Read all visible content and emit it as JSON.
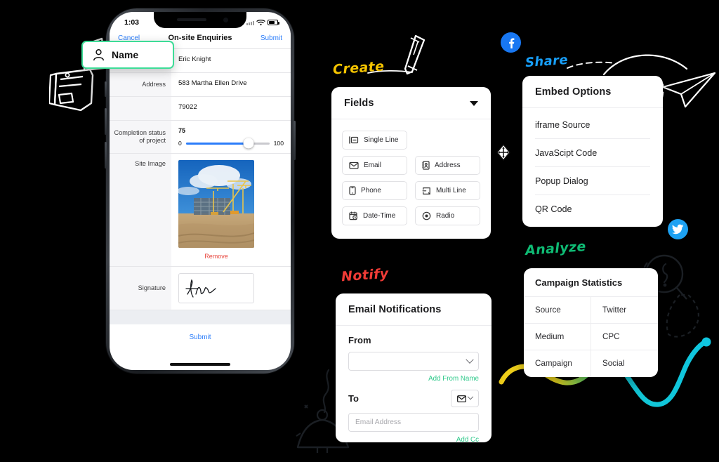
{
  "theme": {
    "background": "#000000",
    "accent_green": "#3ddc97",
    "accent_blue": "#2b7dfa",
    "link_green": "#2fc98b",
    "danger_red": "#e8453c"
  },
  "phone": {
    "status_bar": {
      "time": "1:03",
      "signal_icon": "signal-bars-icon",
      "wifi_icon": "wifi-icon",
      "battery_icon": "battery-icon"
    },
    "nav": {
      "cancel": "Cancel",
      "title": "On-site Enquiries",
      "submit": "Submit"
    },
    "form": {
      "rows": [
        {
          "label": "Name",
          "value": "Eric Knight"
        },
        {
          "label": "Address",
          "value": "583 Martha Ellen Drive"
        },
        {
          "label": "",
          "value": "79022"
        }
      ],
      "slider": {
        "label": "Completion status of project",
        "value": "75",
        "min": "0",
        "max": "100"
      },
      "image": {
        "label": "Site Image",
        "remove": "Remove",
        "alt": "construction-site-photo"
      },
      "signature": {
        "label": "Signature",
        "alt": "handwritten-signature"
      },
      "submit": "Submit"
    }
  },
  "fields_panel": {
    "title": "Fields",
    "caret_icon": "chevron-down-icon",
    "selected": {
      "label": "Name",
      "icon": "person-icon"
    },
    "items": [
      {
        "label": "Single Line",
        "icon": "single-line-icon"
      },
      {
        "label": "Email",
        "icon": "envelope-icon"
      },
      {
        "label": "Address",
        "icon": "address-card-icon"
      },
      {
        "label": "Phone",
        "icon": "phone-icon"
      },
      {
        "label": "Multi Line",
        "icon": "multi-line-icon"
      },
      {
        "label": "Date-Time",
        "icon": "calendar-clock-icon"
      },
      {
        "label": "Radio",
        "icon": "radio-button-icon"
      }
    ],
    "drag_handle_icon": "move-handle-icon"
  },
  "embed_panel": {
    "title": "Embed Options",
    "items": [
      "iframe Source",
      "JavaScipt Code",
      "Popup Dialog",
      "QR Code"
    ]
  },
  "email_panel": {
    "title": "Email Notifications",
    "from_label": "From",
    "from_value": "",
    "from_caret_icon": "chevron-down-icon",
    "add_from_name": "Add From Name",
    "to_label": "To",
    "to_mode_icon": "envelope-icon",
    "to_caret_icon": "chevron-down-icon",
    "to_placeholder": "Email Address",
    "to_value": "",
    "add_cc": "Add Cc"
  },
  "stats_panel": {
    "title": "Campaign Statistics",
    "rows": [
      {
        "key": "Source",
        "value": "Twitter"
      },
      {
        "key": "Medium",
        "value": "CPC"
      },
      {
        "key": "Campaign",
        "value": "Social"
      }
    ]
  },
  "annotations": {
    "create": "Create",
    "share": "Share",
    "notify": "Notify",
    "analyze": "Analyze"
  },
  "social": {
    "facebook": "facebook-icon",
    "twitter": "twitter-icon"
  },
  "doodles": [
    "pencil-doodle",
    "paper-plane-doodle",
    "documents-doodle",
    "bell-doodle",
    "magnifier-doodle",
    "wave-line-yellow-green-cyan",
    "curve-line-cyan"
  ]
}
